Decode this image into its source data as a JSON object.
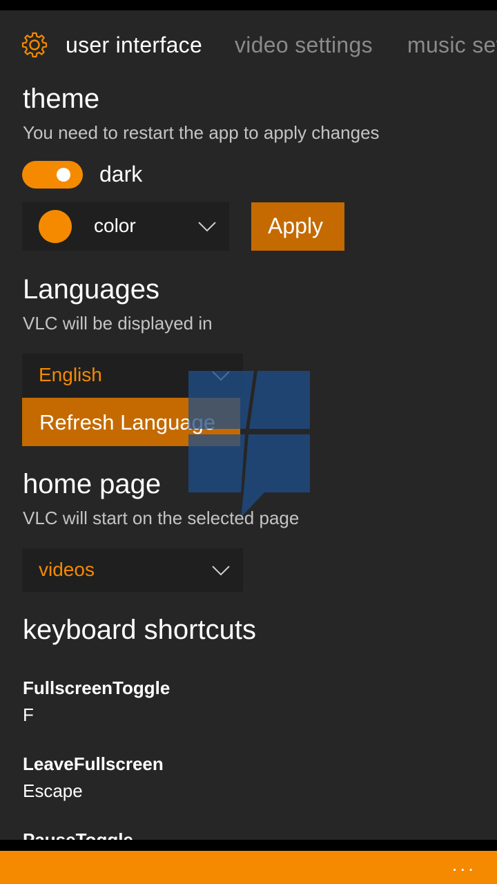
{
  "pivot": {
    "tabs": [
      {
        "label": "user interface",
        "active": true
      },
      {
        "label": "video settings",
        "active": false
      },
      {
        "label": "music settings",
        "active": false
      }
    ]
  },
  "theme": {
    "title": "theme",
    "subtitle": "You need to restart the app to apply changes",
    "dark_toggle_label": "dark",
    "dark_toggle_on": true,
    "color_select_value": "color",
    "color_swatch": "#f58a00",
    "apply_label": "Apply"
  },
  "languages": {
    "title": "Languages",
    "subtitle": "VLC will be displayed in",
    "selected": "English",
    "refresh_label": "Refresh Language"
  },
  "home_page": {
    "title": "home page",
    "subtitle": "VLC will start on the selected page",
    "selected": "videos"
  },
  "keyboard_shortcuts": {
    "title": "keyboard shortcuts",
    "items": [
      {
        "name": "FullscreenToggle",
        "key": "F"
      },
      {
        "name": "LeaveFullscreen",
        "key": "Escape"
      },
      {
        "name": "PauseToggle",
        "key": ""
      }
    ]
  },
  "app_bar": {
    "more_label": "..."
  },
  "colors": {
    "accent": "#f58a00",
    "button_fill": "#c46a00",
    "background": "#262626"
  }
}
